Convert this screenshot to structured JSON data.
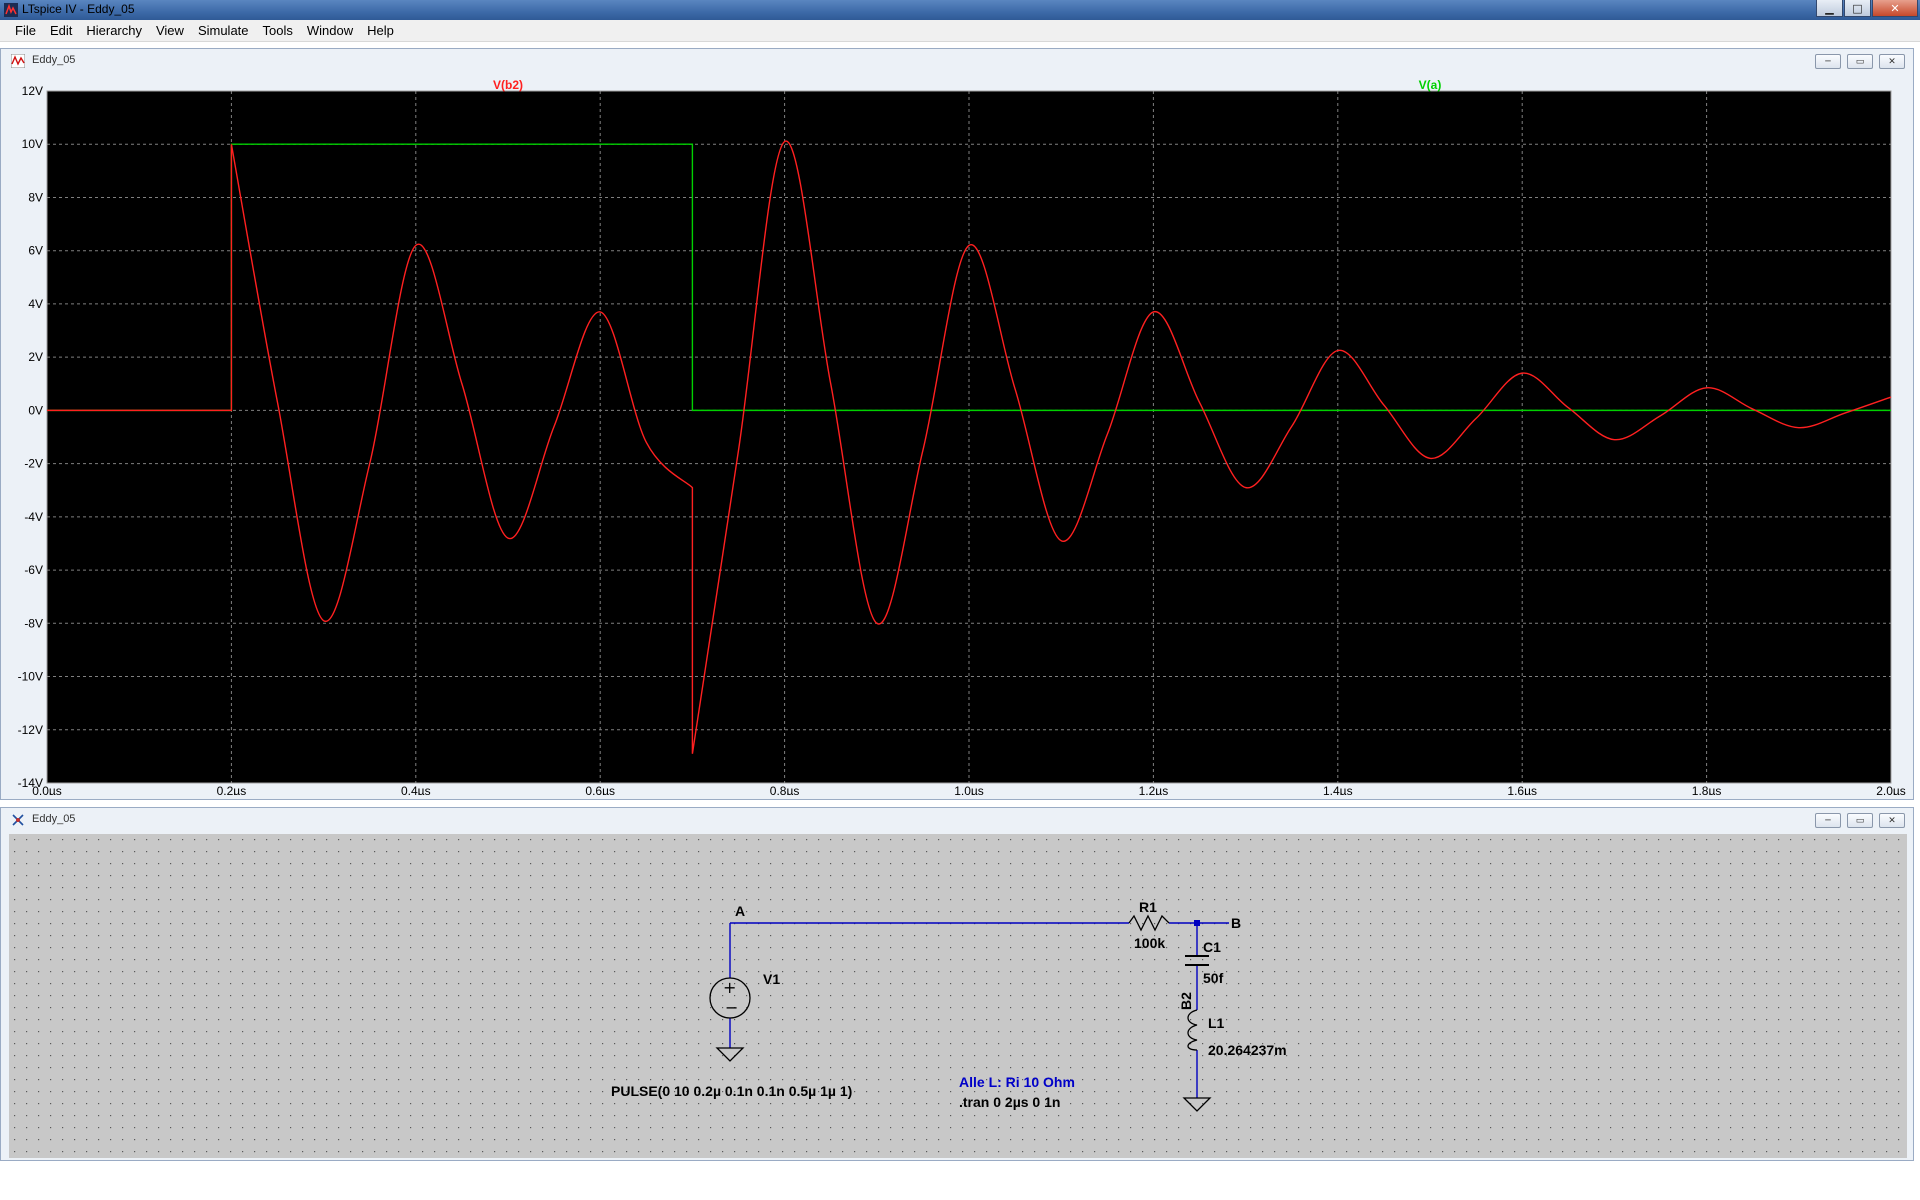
{
  "window": {
    "title": "LTspice IV - Eddy_05",
    "minimize_glyph": "▁",
    "maximize_glyph": "□",
    "close_glyph": "✕"
  },
  "menu": [
    {
      "label": "File"
    },
    {
      "label": "Edit"
    },
    {
      "label": "Hierarchy"
    },
    {
      "label": "View"
    },
    {
      "label": "Simulate"
    },
    {
      "label": "Tools"
    },
    {
      "label": "Window"
    },
    {
      "label": "Help"
    }
  ],
  "waveform_window": {
    "title": "Eddy_05",
    "icon": "waveform-icon",
    "mdi_buttons": [
      "─",
      "▭",
      "✕"
    ]
  },
  "schematic_window": {
    "title": "Eddy_05",
    "icon": "schematic-icon",
    "mdi_buttons": [
      "─",
      "▭",
      "✕"
    ]
  },
  "colors": {
    "plot_bg": "#000000",
    "grid": "#808080",
    "axis_text": "#c8c8c8",
    "trace_vb2": "#ff2020",
    "trace_va": "#00d000",
    "wire": "#0000c0",
    "schematic_bg": "#c8c8c8",
    "schematic_text": "#000000",
    "comment_text": "#0000c8"
  },
  "chart_data": {
    "type": "line",
    "x_axis": {
      "range": [
        0,
        2.0
      ],
      "unit": "µs",
      "ticks": [
        0.0,
        0.2,
        0.4,
        0.6,
        0.8,
        1.0,
        1.2,
        1.4,
        1.6,
        1.8,
        2.0
      ],
      "tick_labels": [
        "0.0µs",
        "0.2µs",
        "0.4µs",
        "0.6µs",
        "0.8µs",
        "1.0µs",
        "1.2µs",
        "1.4µs",
        "1.6µs",
        "1.8µs",
        "2.0µs"
      ]
    },
    "y_axis": {
      "range": [
        -14,
        12
      ],
      "unit": "V",
      "ticks": [
        12,
        10,
        8,
        6,
        4,
        2,
        0,
        -2,
        -4,
        -6,
        -8,
        -10,
        -12,
        -14
      ],
      "tick_labels": [
        "12V",
        "10V",
        "8V",
        "6V",
        "4V",
        "2V",
        "0V",
        "-2V",
        "-4V",
        "-6V",
        "-8V",
        "-10V",
        "-12V",
        "-14V"
      ]
    },
    "grid": true,
    "series": [
      {
        "name": "V(b2)",
        "color": "#ff2020",
        "points": [
          [
            0.0,
            0
          ],
          [
            0.2,
            0
          ],
          [
            0.2,
            10
          ],
          [
            0.25,
            0.3
          ],
          [
            0.3,
            -7.9
          ],
          [
            0.35,
            -2.0
          ],
          [
            0.4,
            6.2
          ],
          [
            0.45,
            1.0
          ],
          [
            0.5,
            -4.8
          ],
          [
            0.55,
            -0.6
          ],
          [
            0.6,
            3.7
          ],
          [
            0.65,
            -1.2
          ],
          [
            0.7,
            -2.9
          ],
          [
            0.7,
            -12.9
          ],
          [
            0.75,
            -1.5
          ],
          [
            0.8,
            10.1
          ],
          [
            0.85,
            1.0
          ],
          [
            0.9,
            -8.0
          ],
          [
            0.95,
            -1.5
          ],
          [
            1.0,
            6.2
          ],
          [
            1.05,
            0.8
          ],
          [
            1.1,
            -4.9
          ],
          [
            1.15,
            -0.9
          ],
          [
            1.2,
            3.7
          ],
          [
            1.25,
            0.3
          ],
          [
            1.3,
            -2.9
          ],
          [
            1.35,
            -0.6
          ],
          [
            1.4,
            2.25
          ],
          [
            1.45,
            0.2
          ],
          [
            1.5,
            -1.8
          ],
          [
            1.55,
            -0.3
          ],
          [
            1.6,
            1.4
          ],
          [
            1.65,
            0.1
          ],
          [
            1.7,
            -1.1
          ],
          [
            1.75,
            -0.2
          ],
          [
            1.8,
            0.85
          ],
          [
            1.85,
            0.05
          ],
          [
            1.9,
            -0.65
          ],
          [
            1.95,
            -0.1
          ],
          [
            2.0,
            0.5
          ]
        ]
      },
      {
        "name": "V(a)",
        "color": "#00d000",
        "points": [
          [
            0.0,
            0
          ],
          [
            0.2,
            0
          ],
          [
            0.2,
            10
          ],
          [
            0.7,
            10
          ],
          [
            0.7,
            0
          ],
          [
            2.0,
            0
          ]
        ]
      }
    ]
  },
  "schematic": {
    "labels": {
      "net_a": "A",
      "net_b": "B",
      "r1_name": "R1",
      "r1_value": "100k",
      "c1_name": "C1",
      "c1_value": "50f",
      "b2_label": "B2",
      "l1_name": "L1",
      "l1_value": "20.264237m",
      "v1_name": "V1",
      "v1_value": "PULSE(0 10 0.2µ 0.1n 0.1n 0.5µ 1µ 1)",
      "comment": "Alle L: Ri 10 Ohm",
      "directive": ".tran 0 2µs 0 1n"
    }
  }
}
